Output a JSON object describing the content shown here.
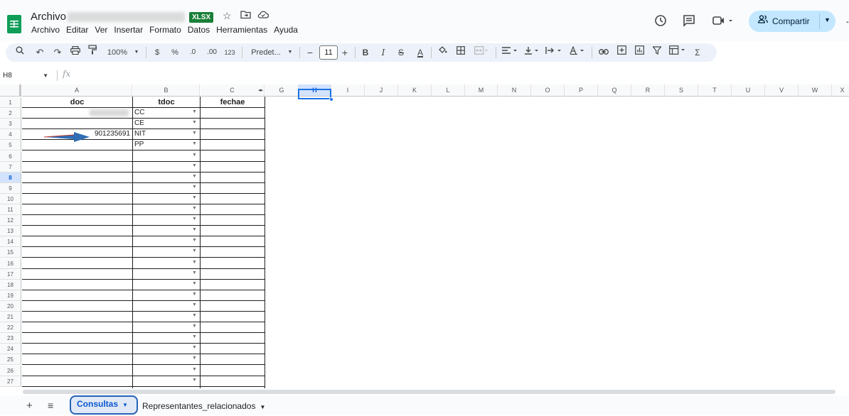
{
  "header": {
    "title": "Archivo",
    "format_badge": "XLSX",
    "share_label": "Compartir"
  },
  "menu": [
    "Archivo",
    "Editar",
    "Ver",
    "Insertar",
    "Formato",
    "Datos",
    "Herramientas",
    "Ayuda"
  ],
  "toolbar": {
    "zoom": "100%",
    "currency": "$",
    "percent": "%",
    "dec_decrease": ".0",
    "dec_increase": ".00",
    "number_format": "123",
    "font": "Predet...",
    "font_size": "11",
    "bold": "B",
    "italic": "I",
    "strike": "S",
    "text_color": "A"
  },
  "formula_bar": {
    "cell_ref": "H8",
    "fx": "fx",
    "content": ""
  },
  "columns": [
    "A",
    "B",
    "C",
    "G",
    "H",
    "I",
    "J",
    "K",
    "L",
    "M",
    "N",
    "O",
    "P",
    "Q",
    "R",
    "S",
    "T",
    "U",
    "V",
    "W",
    "X"
  ],
  "rows": [
    "1",
    "2",
    "3",
    "4",
    "5",
    "6",
    "7",
    "8",
    "9",
    "10",
    "11",
    "12",
    "13",
    "14",
    "15",
    "16",
    "17",
    "18",
    "19",
    "20",
    "21",
    "22",
    "23",
    "24",
    "25",
    "26",
    "27"
  ],
  "table": {
    "headers": [
      "doc",
      "tdoc",
      "fechae"
    ],
    "doc_values": [
      "",
      "",
      "901235691"
    ],
    "tdoc_values": [
      "CC",
      "CE",
      "NIT",
      "PP"
    ]
  },
  "selected_cell": "H8",
  "sheets": [
    {
      "name": "Consultas",
      "active": true
    },
    {
      "name": "Representantes_relacionados",
      "active": false
    }
  ],
  "colors": {
    "accent": "#0b57d0",
    "share_bg": "#c2e7ff",
    "badge": "#188038",
    "arrow": "#2f6db5"
  }
}
